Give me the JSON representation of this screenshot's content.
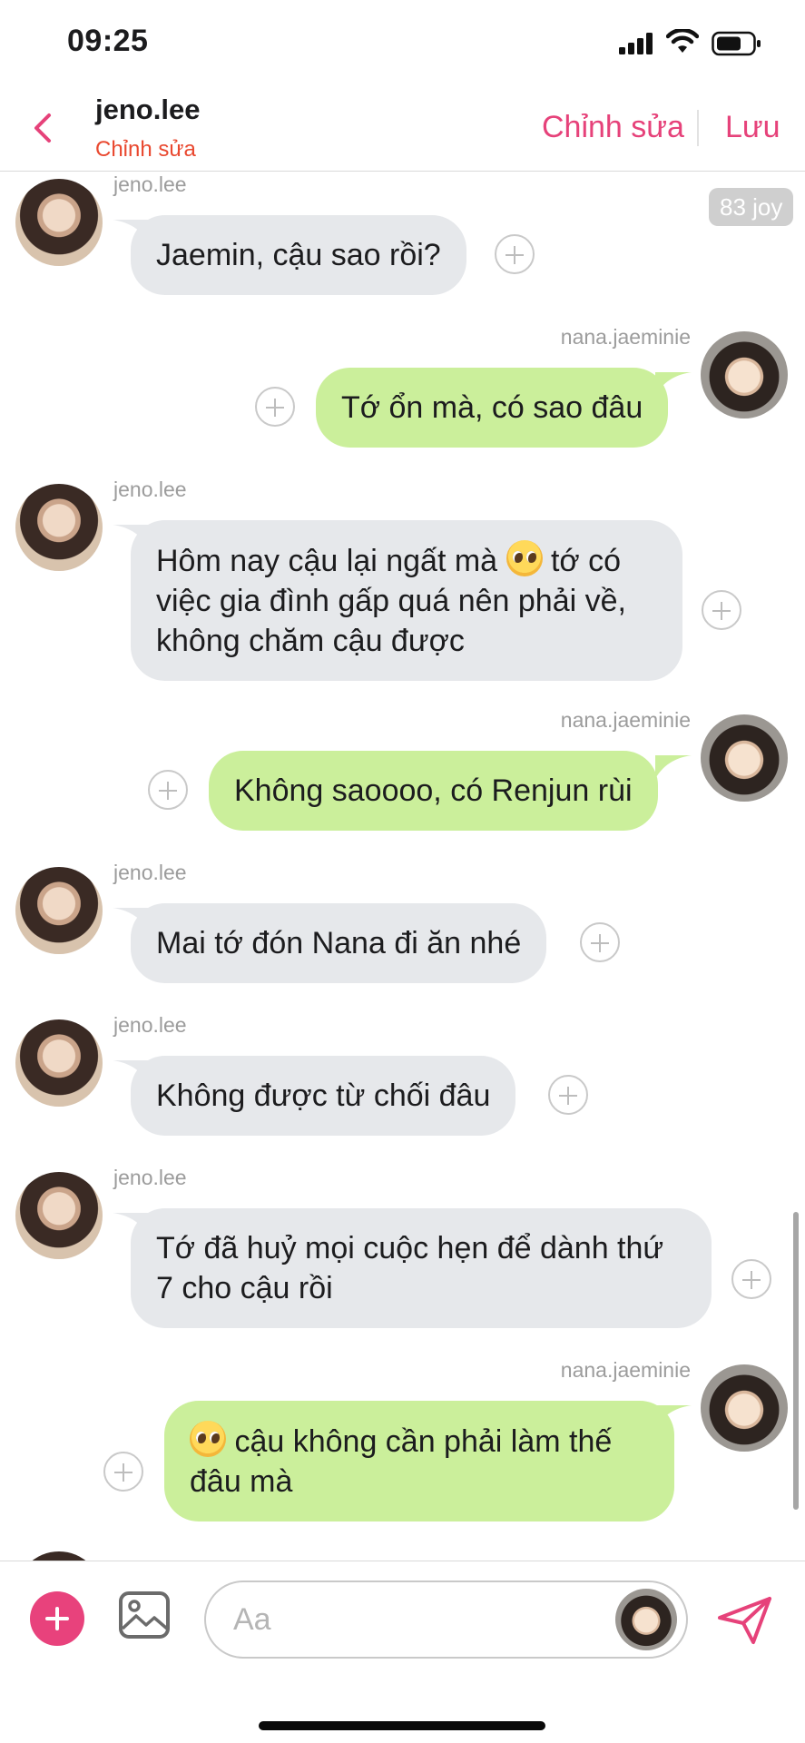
{
  "status_bar": {
    "time": "09:25"
  },
  "header": {
    "back_icon": "chevron-left-icon",
    "name": "jeno.lee",
    "subtitle": "Chỉnh sửa",
    "edit_label": "Chỉnh sửa",
    "save_label": "Lưu"
  },
  "joy_badge": "83 joy",
  "messages": [
    {
      "sender": "jeno.lee",
      "direction": "in",
      "text": "Jaemin, cậu sao rồi?"
    },
    {
      "sender": "nana.jaeminie",
      "direction": "out",
      "text": "Tớ ổn mà, có sao đâu"
    },
    {
      "sender": "jeno.lee",
      "direction": "in",
      "line1_before_emoji": "Hôm nay cậu lại ngất mà ",
      "line1_after_emoji": " tớ có",
      "line2": "việc gia đình gấp quá nên phải về,",
      "line3": "không chăm cậu được",
      "emoji": "pleading-face-emoji"
    },
    {
      "sender": "nana.jaeminie",
      "direction": "out",
      "text": "Không saoooo, có Renjun rùi"
    },
    {
      "sender": "jeno.lee",
      "direction": "in",
      "text": "Mai tớ đón Nana đi ăn nhé"
    },
    {
      "sender": "jeno.lee",
      "direction": "in",
      "text": "Không được từ chối đâu"
    },
    {
      "sender": "jeno.lee",
      "direction": "in",
      "line1": "Tớ đã huỷ mọi cuộc hẹn để dành thứ",
      "line2": "7 cho cậu rồi"
    },
    {
      "sender": "nana.jaeminie",
      "direction": "out",
      "line1_after_emoji": " cậu không cần phải làm thế",
      "line2": "đâu mà",
      "emoji": "pleading-face-emoji"
    }
  ],
  "composer": {
    "placeholder": "Aa",
    "add_icon": "plus-icon",
    "image_icon": "image-icon",
    "send_icon": "send-icon"
  },
  "colors": {
    "accent": "#e6427a",
    "subtitle_red": "#e9482f",
    "incoming_bubble": "#e6e8eb",
    "outgoing_bubble": "#cbef9b"
  }
}
